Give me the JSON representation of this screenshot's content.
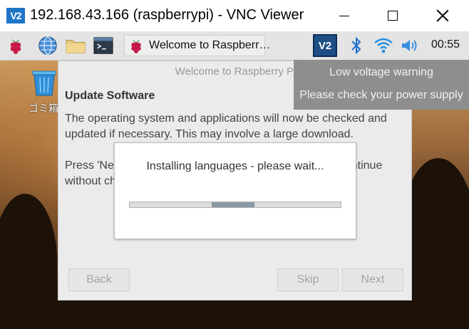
{
  "window": {
    "title": "192.168.43.166 (raspberrypi) - VNC Viewer",
    "logo_text": "V2"
  },
  "taskbar": {
    "icons": [
      "raspberry-pi-menu-icon",
      "globe-icon",
      "folder-icon",
      "terminal-icon"
    ],
    "task_label": "Welcome to Raspberr…",
    "tray": {
      "vnc_label": "V2",
      "clock": "00:55"
    }
  },
  "desktop": {
    "trash_label": "ゴミ箱"
  },
  "dialog": {
    "title": "Welcome to Raspberry Pi",
    "heading": "Update Software",
    "body": "The operating system and applications will now be checked and updated if necessary. This may involve a large download.",
    "press_text": "Press 'Next' to check and update software, or 'Skip' to continue without checking.",
    "buttons": {
      "back": "Back",
      "skip": "Skip",
      "next": "Next"
    }
  },
  "progress": {
    "message": "Installing languages - please wait...",
    "indeterminate_segment": {
      "start": 0.39,
      "end": 0.59
    }
  },
  "notification": {
    "line1": "Low voltage warning",
    "line2": "Please check your power supply"
  },
  "colors": {
    "vnc_blue": "#1f76c9",
    "notification_bg": "#8e8e8e",
    "progress_fill": "#8a9aa6"
  }
}
